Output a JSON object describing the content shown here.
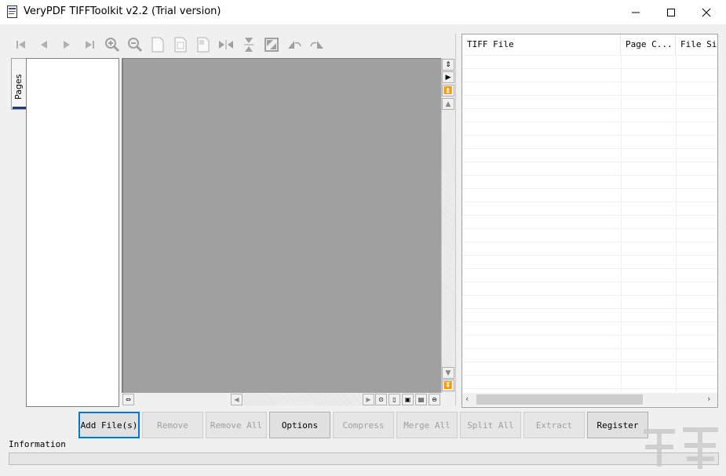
{
  "window": {
    "title": "VeryPDF TIFFToolkit v2.2 (Trial version)"
  },
  "toolbar": {
    "icons": [
      "first-page-icon",
      "prev-page-icon",
      "next-page-icon",
      "last-page-icon",
      "zoom-in-icon",
      "zoom-out-icon",
      "fit-page-icon",
      "fit-width-icon",
      "actual-size-icon",
      "flip-horizontal-icon",
      "flip-vertical-icon",
      "rotate-icon",
      "rotate-left-icon",
      "rotate-right-icon"
    ]
  },
  "side_tab": {
    "label": "Pages"
  },
  "file_list": {
    "columns": [
      {
        "label": "TIFF File"
      },
      {
        "label": "Page C..."
      },
      {
        "label": "File Siz"
      }
    ]
  },
  "buttons": {
    "add_files": "Add File(s)",
    "remove": "Remove",
    "remove_all": "Remove All",
    "options": "Options",
    "compress": "Compress",
    "merge_all": "Merge All",
    "split_all": "Split All",
    "extract": "Extract",
    "register": "Register"
  },
  "status": {
    "info_label": "Information"
  },
  "colors": {
    "viewer_bg": "#a0a0a0",
    "focus_border": "#0078d7"
  }
}
